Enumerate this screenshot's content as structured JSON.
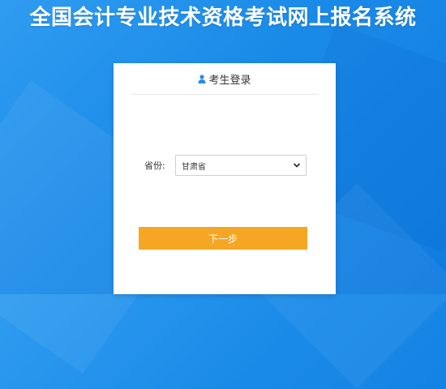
{
  "header": {
    "title": "全国会计专业技术资格考试网上报名系统"
  },
  "login_card": {
    "title": "考生登录",
    "title_icon": "user-icon",
    "province_label": "省份:",
    "province_value": "甘肃省",
    "dropdown_icon": "chevron-down-icon",
    "next_button_label": "下一步"
  },
  "colors": {
    "background": "#1a8ae8",
    "card": "#ffffff",
    "accent_button": "#f5a623",
    "icon": "#2a8be6"
  }
}
